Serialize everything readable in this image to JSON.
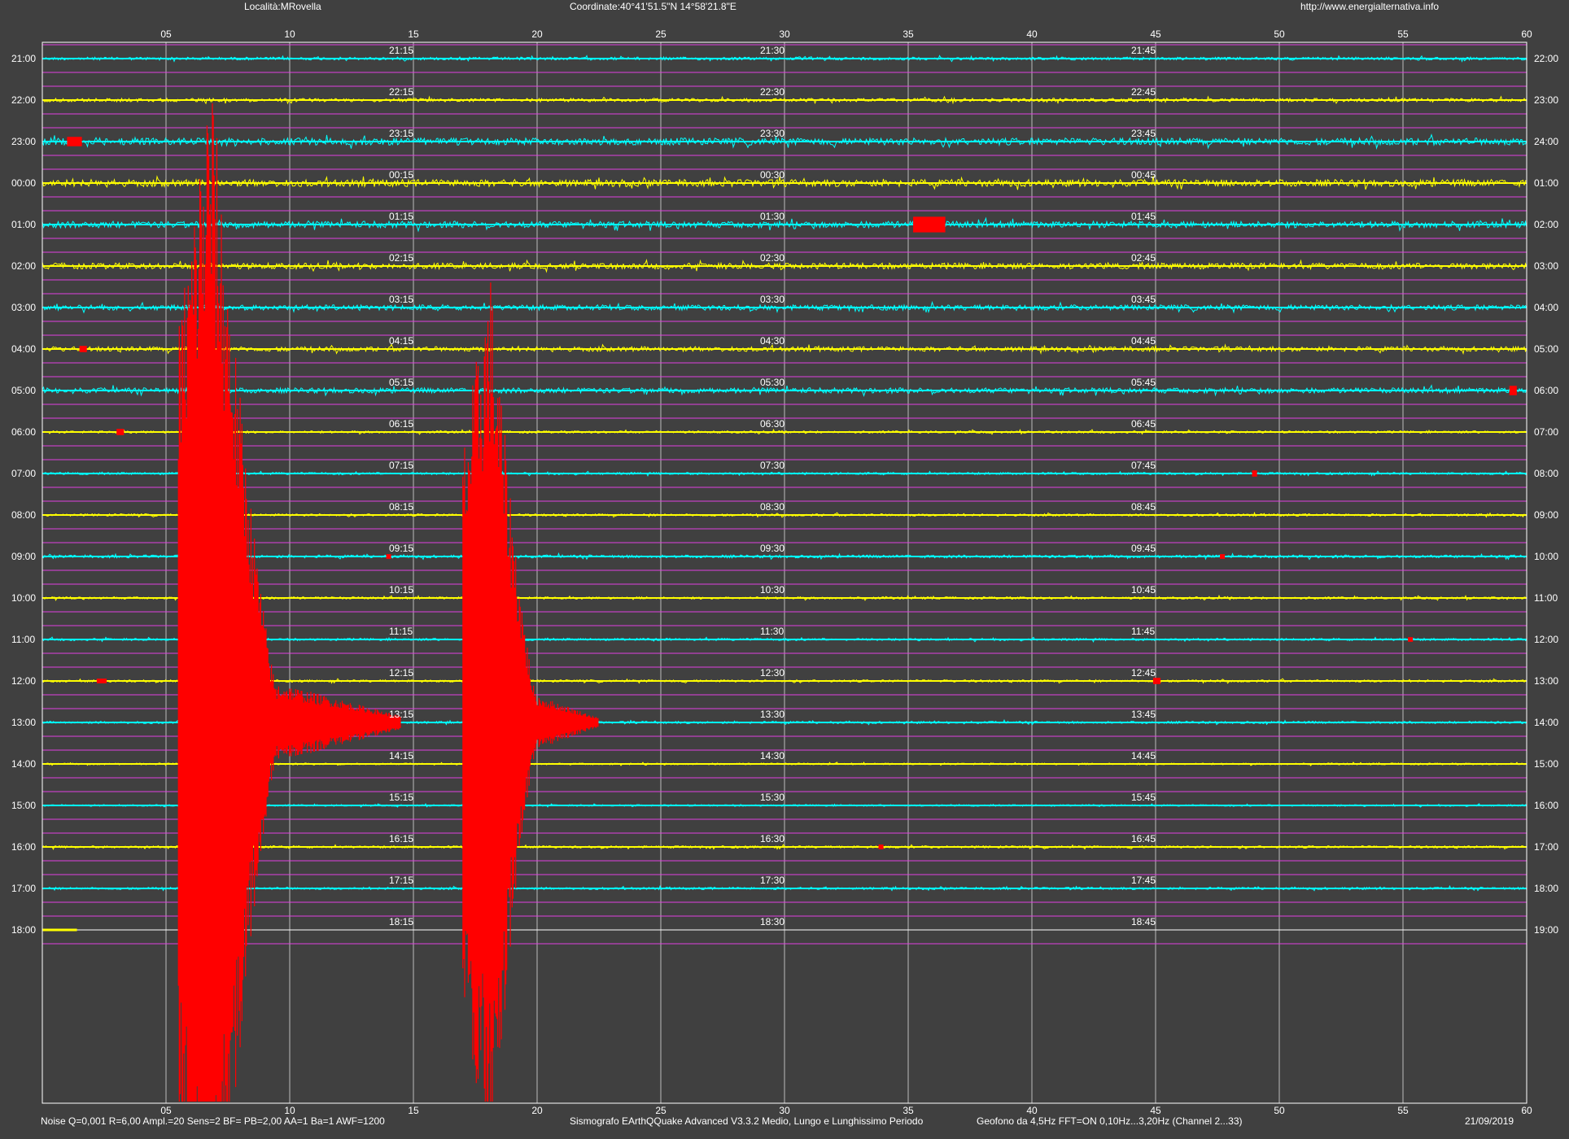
{
  "header": {
    "locality": "Località:MRovella",
    "coordinates": "Coordinate:40°41'51.5\"N 14°58'21.8\"E",
    "website": "http://www.energialternativa.info"
  },
  "footer": {
    "settings": "Noise Q=0,001 R=6,00 Ampl.=20 Sens=2 BF= PB=2,00 AA=1 Ba=1 AWF=1200",
    "software": "Sismografo  EArthQQuake Advanced V3.3.2  Medio, Lungo e Lunghissimo Periodo",
    "sensor": "Geofono da 4,5Hz FFT=ON 0,10Hz...3,20Hz      (Channel 2...33)",
    "date": "21/09/2019"
  },
  "colors": {
    "background": "#404040",
    "frame": "#ffffff",
    "grid_minor": "#e040e0",
    "grid_major": "#bdbdbd",
    "trace_a": "#00ffff",
    "trace_b": "#ffff00",
    "event": "#ff0000",
    "last_line": "#ffffff"
  },
  "chart_data": {
    "type": "seismogram",
    "x_unit": "minutes",
    "xlim": [
      0,
      60
    ],
    "x_ticks": [
      "05",
      "10",
      "15",
      "20",
      "25",
      "30",
      "35",
      "40",
      "45",
      "50",
      "55",
      "60"
    ],
    "left_labels": [
      "21:00",
      "22:00",
      "23:00",
      "00:00",
      "01:00",
      "02:00",
      "03:00",
      "04:00",
      "05:00",
      "06:00",
      "07:00",
      "08:00",
      "09:00",
      "10:00",
      "11:00",
      "12:00",
      "13:00",
      "14:00",
      "15:00",
      "16:00",
      "17:00",
      "18:00"
    ],
    "right_labels": [
      "22:00",
      "23:00",
      "24:00",
      "01:00",
      "02:00",
      "03:00",
      "04:00",
      "05:00",
      "06:00",
      "07:00",
      "08:00",
      "09:00",
      "10:00",
      "11:00",
      "12:00",
      "13:00",
      "14:00",
      "15:00",
      "16:00",
      "17:00",
      "18:00",
      "19:00"
    ],
    "quarter_labels": [
      [
        "21:15",
        "21:30",
        "21:45"
      ],
      [
        "22:15",
        "22:30",
        "22:45"
      ],
      [
        "23:15",
        "23:30",
        "23:45"
      ],
      [
        "00:15",
        "00:30",
        "00:45"
      ],
      [
        "01:15",
        "01:30",
        "01:45"
      ],
      [
        "02:15",
        "02:30",
        "02:45"
      ],
      [
        "03:15",
        "03:30",
        "03:45"
      ],
      [
        "04:15",
        "04:30",
        "04:45"
      ],
      [
        "05:15",
        "05:30",
        "05:45"
      ],
      [
        "06:15",
        "06:30",
        "06:45"
      ],
      [
        "07:15",
        "07:30",
        "07:45"
      ],
      [
        "08:15",
        "08:30",
        "08:45"
      ],
      [
        "09:15",
        "09:30",
        "09:45"
      ],
      [
        "10:15",
        "10:30",
        "10:45"
      ],
      [
        "11:15",
        "11:30",
        "11:45"
      ],
      [
        "12:15",
        "12:30",
        "12:45"
      ],
      [
        "13:15",
        "13:30",
        "13:45"
      ],
      [
        "14:15",
        "14:30",
        "14:45"
      ],
      [
        "15:15",
        "15:30",
        "15:45"
      ],
      [
        "16:15",
        "16:30",
        "16:45"
      ],
      [
        "17:15",
        "17:30",
        "17:45"
      ],
      [
        "18:15",
        "18:30",
        "18:45"
      ]
    ],
    "row_noise": [
      0.25,
      0.3,
      0.6,
      0.6,
      0.55,
      0.5,
      0.45,
      0.4,
      0.45,
      0.2,
      0.2,
      0.2,
      0.25,
      0.2,
      0.2,
      0.2,
      0.2,
      0.15,
      0.15,
      0.2,
      0.2,
      0.1
    ],
    "trace_end_minute_last_row": 1.4,
    "events": [
      {
        "row": 16,
        "minute": 5.5,
        "minute_end": 9.5,
        "peak_minute": 6.8,
        "amplitude": 16,
        "type": "earthquake",
        "tail_end_minute": 14.5
      },
      {
        "row": 16,
        "minute": 17.0,
        "minute_end": 20.0,
        "peak_minute": 18.1,
        "amplitude": 11,
        "type": "earthquake",
        "tail_end_minute": 22.5
      },
      {
        "row": 2,
        "minute": 1.0,
        "minute_end": 1.6,
        "amplitude": 0.6,
        "type": "spike"
      },
      {
        "row": 4,
        "minute": 35.2,
        "minute_end": 36.5,
        "amplitude": 1.0,
        "type": "spike"
      },
      {
        "row": 7,
        "minute": 1.5,
        "minute_end": 1.8,
        "amplitude": 0.4,
        "type": "spike"
      },
      {
        "row": 8,
        "minute": 59.3,
        "minute_end": 59.6,
        "amplitude": 0.6,
        "type": "spike"
      },
      {
        "row": 9,
        "minute": 3.0,
        "minute_end": 3.3,
        "amplitude": 0.4,
        "type": "spike"
      },
      {
        "row": 10,
        "minute": 48.9,
        "minute_end": 49.1,
        "amplitude": 0.4,
        "type": "spike"
      },
      {
        "row": 12,
        "minute": 47.6,
        "minute_end": 47.8,
        "amplitude": 0.3,
        "type": "spike"
      },
      {
        "row": 12,
        "minute": 13.9,
        "minute_end": 14.1,
        "amplitude": 0.3,
        "type": "spike"
      },
      {
        "row": 14,
        "minute": 55.2,
        "minute_end": 55.4,
        "amplitude": 0.3,
        "type": "spike"
      },
      {
        "row": 15,
        "minute": 2.2,
        "minute_end": 2.6,
        "amplitude": 0.3,
        "type": "spike"
      },
      {
        "row": 15,
        "minute": 44.9,
        "minute_end": 45.2,
        "amplitude": 0.4,
        "type": "spike"
      },
      {
        "row": 19,
        "minute": 33.8,
        "minute_end": 34.0,
        "amplitude": 0.3,
        "type": "spike"
      }
    ]
  }
}
